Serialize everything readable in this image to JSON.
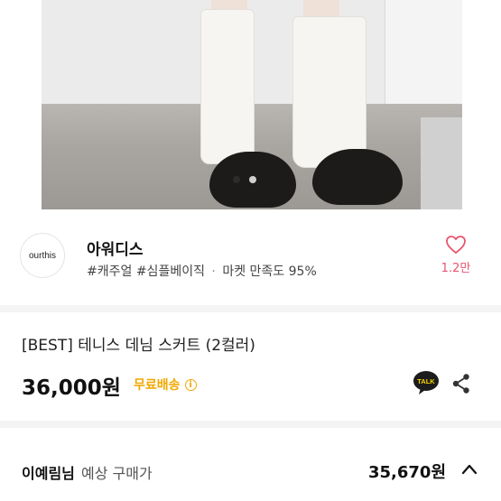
{
  "carousel": {
    "total": 2,
    "active": 0
  },
  "seller": {
    "logo_text": "ourthis",
    "name": "아워디스",
    "tags": [
      "#캐주얼",
      "#심플베이직"
    ],
    "separator": "·",
    "satisfaction": "마켓 만족도 95%",
    "likes": "1.2만"
  },
  "product": {
    "title": "[BEST] 테니스 데님 스커트 (2컬러)",
    "price": "36,000원",
    "shipping": "무료배송",
    "talk_label": "TALK"
  },
  "expected": {
    "user": "이예림님",
    "label": "예상 구매가",
    "price": "35,670원"
  },
  "colors": {
    "accent": "#e8546e",
    "shipping": "#f1a800",
    "talk": "#1c1c1c"
  }
}
